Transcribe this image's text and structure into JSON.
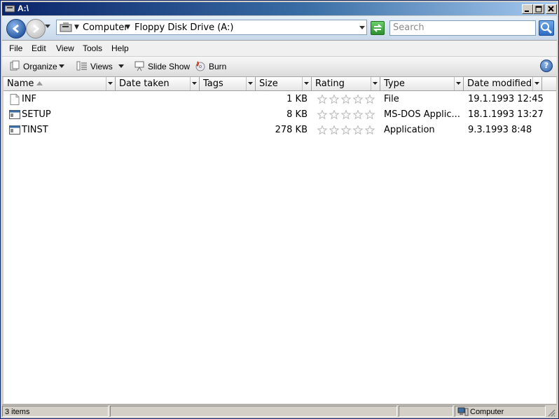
{
  "window": {
    "title": "A:\\"
  },
  "address": {
    "crumbs": [
      "Computer",
      "Floppy Disk Drive (A:)"
    ]
  },
  "search": {
    "placeholder": "Search"
  },
  "menu": [
    "File",
    "Edit",
    "View",
    "Tools",
    "Help"
  ],
  "commands": {
    "organize": "Organize",
    "views": "Views",
    "slideshow": "Slide Show",
    "burn": "Burn"
  },
  "columns": [
    "Name",
    "Date taken",
    "Tags",
    "Size",
    "Rating",
    "Type",
    "Date modified"
  ],
  "files": [
    {
      "name": "INF",
      "size": "1 KB",
      "type": "File",
      "modified": "19.1.1993 12:45",
      "icon": "file-icon",
      "rating": 0
    },
    {
      "name": "SETUP",
      "size": "8 KB",
      "type": "MS-DOS Applic...",
      "modified": "18.1.1993 13:27",
      "icon": "application-icon",
      "rating": 0
    },
    {
      "name": "TINST",
      "size": "278 KB",
      "type": "Application",
      "modified": "9.3.1993 8:48",
      "icon": "application-icon",
      "rating": 0
    }
  ],
  "status": {
    "items": "3 items",
    "location": "Computer"
  },
  "colors": {
    "title_start": "#0a246a",
    "title_end": "#a6caf0",
    "face": "#d4d0c8"
  }
}
